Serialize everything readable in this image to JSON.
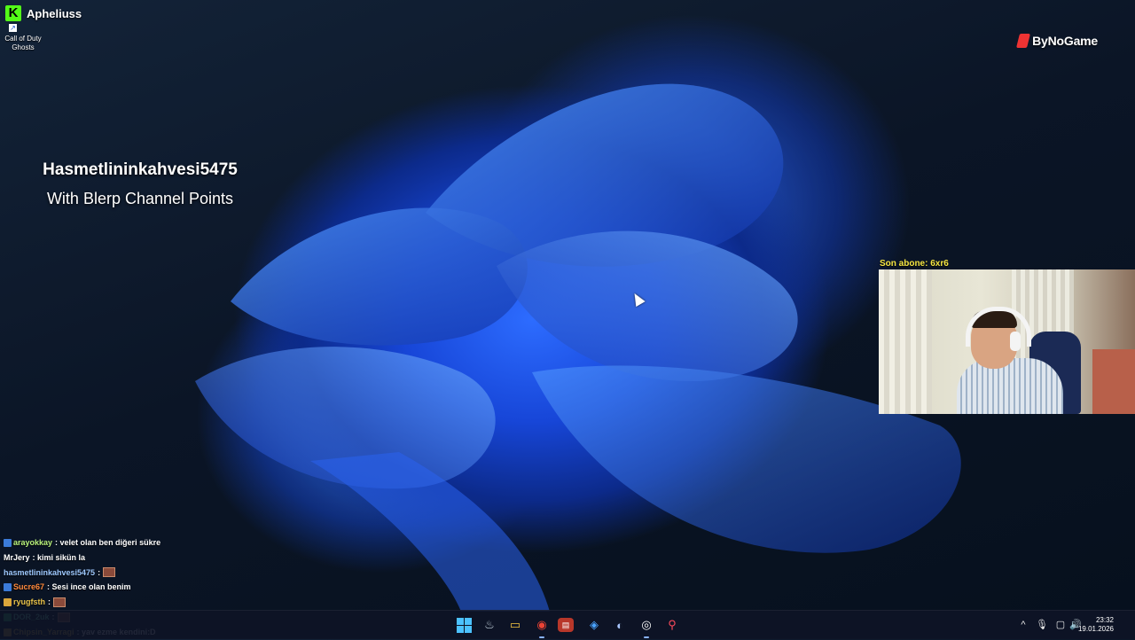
{
  "streamer": {
    "name": "Apheliuss",
    "logo_icon": "kick-logo-icon"
  },
  "desktop_shortcut": {
    "label": "Call of Duty Ghosts"
  },
  "brand": {
    "text": "ByNoGame"
  },
  "alert": {
    "username": "Hasmetlininkahvesi5475",
    "subtitle": "With Blerp Channel Points"
  },
  "webcam": {
    "last_sub_label": "Son abone: 6xr6"
  },
  "chat": [
    {
      "badge": "blue",
      "user": "arayokkay",
      "user_color": "#b9f27c",
      "msg": ": velet olan ben diğeri sükre",
      "emote": false
    },
    {
      "badge": "",
      "user": "MrJery",
      "user_color": "#ffffff",
      "msg": ": kimi sikün la",
      "emote": false
    },
    {
      "badge": "",
      "user": "hasmetlininkahvesi5475",
      "user_color": "#9ec9ff",
      "msg": ":",
      "emote": true
    },
    {
      "badge": "blue",
      "user": "Sucre67",
      "user_color": "#ff8a3d",
      "msg": ": Sesi ince olan benim",
      "emote": false
    },
    {
      "badge": "gold",
      "user": "ryugfsth",
      "user_color": "#e7c24a",
      "msg": ":",
      "emote": true
    },
    {
      "badge": "green",
      "user": "DOR_2uk",
      "user_color": "#7ff0c7",
      "msg": ":",
      "emote": true
    },
    {
      "badge": "gold",
      "user": "Chipsin_Yarragi",
      "user_color": "#e7c24a",
      "msg": ": yav ezme kendini:D",
      "emote": false
    }
  ],
  "taskbar": {
    "apps": [
      {
        "name": "start-icon"
      },
      {
        "name": "steam-icon",
        "glyph": "♨"
      },
      {
        "name": "file-explorer-icon",
        "glyph": "▭"
      },
      {
        "name": "chrome-icon",
        "glyph": "◉"
      },
      {
        "name": "streamlabs-icon",
        "glyph": "▤"
      },
      {
        "name": "app-blue-icon",
        "glyph": "◈"
      },
      {
        "name": "app-circle-icon",
        "glyph": "◐"
      },
      {
        "name": "obs-icon",
        "glyph": "◎"
      },
      {
        "name": "maps-pin-icon",
        "glyph": "⚲"
      }
    ],
    "tray": {
      "time": "23:32",
      "date": "19.01.2026"
    }
  }
}
